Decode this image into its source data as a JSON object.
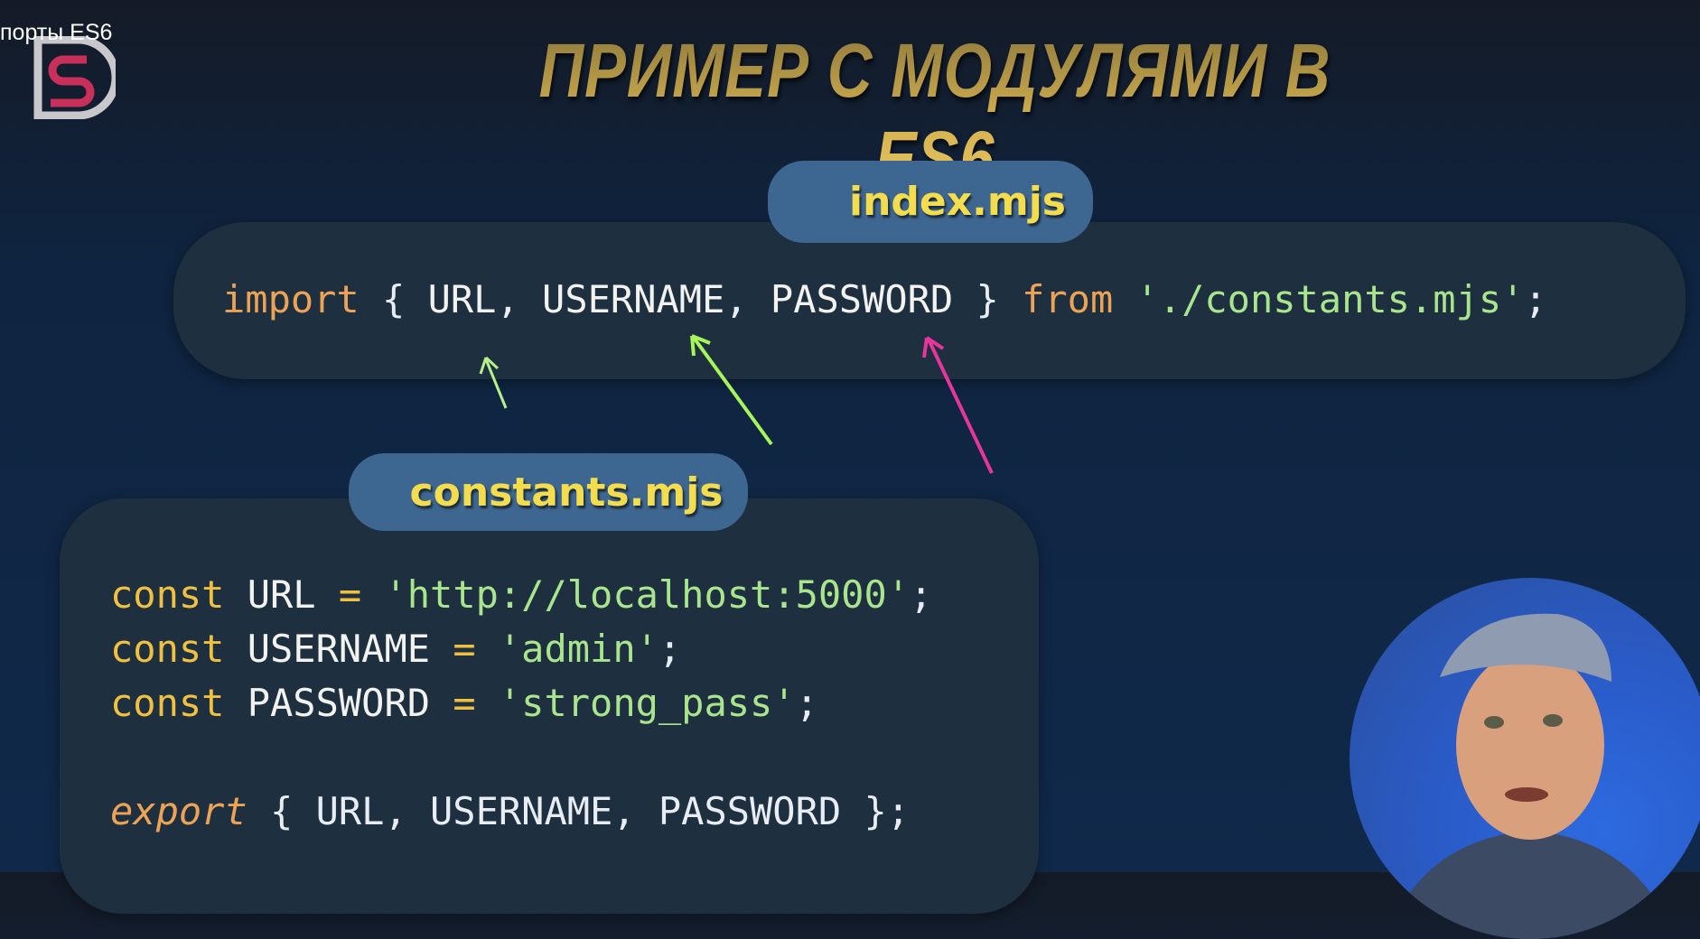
{
  "caption": "порты ES6",
  "logo": {
    "letters": "SD",
    "colors": {
      "outer": "#c8c8cc",
      "inner": "#c8305a"
    }
  },
  "title": "ПРИМЕР С МОДУЛЯМИ В ES6",
  "index_file": {
    "label": "index.mjs",
    "lines": [
      [
        {
          "t": "import",
          "c": "kw"
        },
        {
          "t": " ",
          "c": "pn"
        },
        {
          "t": "{",
          "c": "pn"
        },
        {
          "t": " URL",
          "c": "id"
        },
        {
          "t": ",",
          "c": "pn"
        },
        {
          "t": " USERNAME",
          "c": "id"
        },
        {
          "t": ",",
          "c": "pn"
        },
        {
          "t": " PASSWORD",
          "c": "id"
        },
        {
          "t": " }",
          "c": "pn"
        },
        {
          "t": " from",
          "c": "kw"
        },
        {
          "t": " './constants.mjs'",
          "c": "str"
        },
        {
          "t": ";",
          "c": "pn"
        }
      ]
    ]
  },
  "constants_file": {
    "label": "constants.mjs",
    "lines": [
      [
        {
          "t": "const",
          "c": "op"
        },
        {
          "t": " URL ",
          "c": "id"
        },
        {
          "t": "=",
          "c": "op"
        },
        {
          "t": " 'http://localhost:5000'",
          "c": "str"
        },
        {
          "t": ";",
          "c": "pn"
        }
      ],
      [
        {
          "t": "const",
          "c": "op"
        },
        {
          "t": " USERNAME ",
          "c": "id"
        },
        {
          "t": "=",
          "c": "op"
        },
        {
          "t": " 'admin'",
          "c": "str"
        },
        {
          "t": ";",
          "c": "pn"
        }
      ],
      [
        {
          "t": "const",
          "c": "op"
        },
        {
          "t": " PASSWORD ",
          "c": "id"
        },
        {
          "t": "=",
          "c": "op"
        },
        {
          "t": " 'strong_pass'",
          "c": "str"
        },
        {
          "t": ";",
          "c": "pn"
        }
      ],
      [],
      [
        {
          "t": "export",
          "c": "it"
        },
        {
          "t": " { URL, USERNAME, PASSWORD };",
          "c": "pn"
        }
      ]
    ]
  },
  "arrows": [
    {
      "target": "URL",
      "color": "#b6f08a"
    },
    {
      "target": "USERNAME",
      "color": "#a6f55a"
    },
    {
      "target": "PASSWORD",
      "color": "#e8359b"
    }
  ],
  "presenter": {
    "description_icon": "presenter-video-avatar"
  }
}
